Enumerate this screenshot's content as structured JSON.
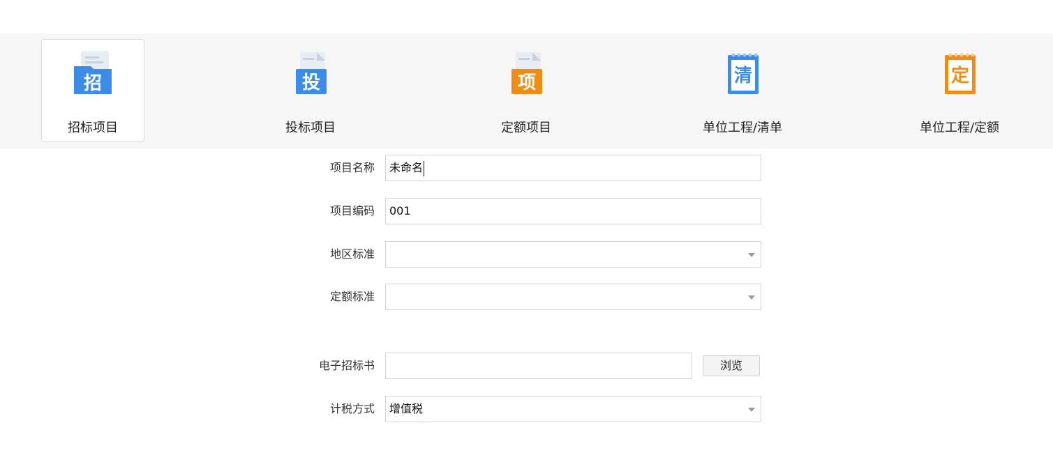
{
  "tabs": [
    {
      "label": "招标项目",
      "icon": "zhao-doc-icon",
      "glyph": "招",
      "color": "#3b8ce8",
      "selected": true
    },
    {
      "label": "投标项目",
      "icon": "tou-doc-icon",
      "glyph": "投",
      "color": "#3b8ce8",
      "selected": false
    },
    {
      "label": "定额项目",
      "icon": "xiang-doc-icon",
      "glyph": "项",
      "color": "#f08c14",
      "selected": false
    },
    {
      "label": "单位工程/清单",
      "icon": "qing-notepad-icon",
      "glyph": "清",
      "color": "#3b8ce8",
      "selected": false
    },
    {
      "label": "单位工程/定额",
      "icon": "ding-notepad-icon",
      "glyph": "定",
      "color": "#f08c14",
      "selected": false
    }
  ],
  "form": {
    "project_name": {
      "label": "项目名称",
      "value": "未命名"
    },
    "project_code": {
      "label": "项目编码",
      "value": "001"
    },
    "region_standard": {
      "label": "地区标准",
      "value": ""
    },
    "quota_standard": {
      "label": "定额标准",
      "value": ""
    },
    "e_tender": {
      "label": "电子招标书",
      "value": "",
      "browse_label": "浏览"
    },
    "tax_method": {
      "label": "计税方式",
      "value": "增值税"
    }
  }
}
